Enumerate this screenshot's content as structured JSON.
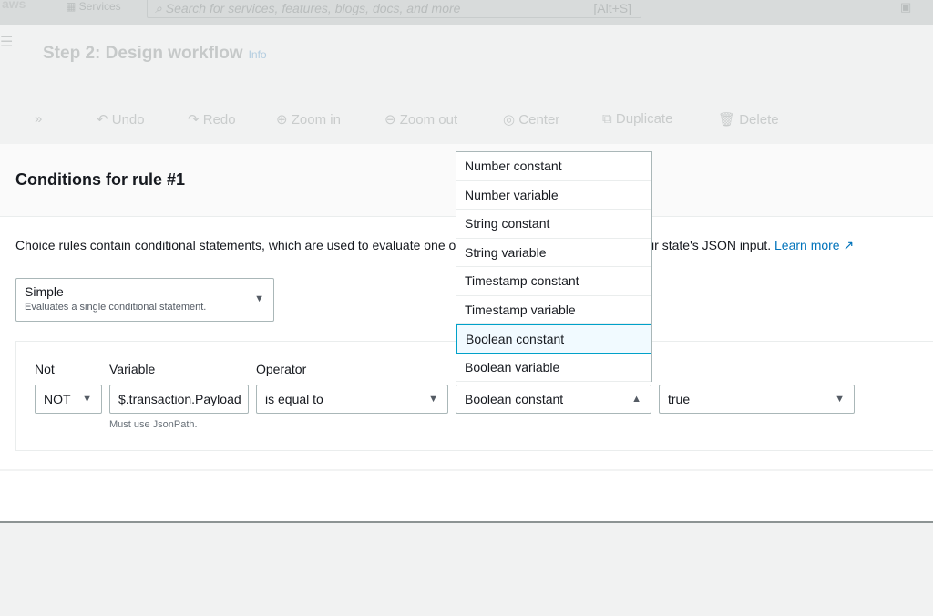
{
  "topnav": {
    "logo": "aws",
    "services": "Services",
    "search_placeholder": "Search for services, features, blogs, docs, and more",
    "search_shortcut": "[Alt+S]"
  },
  "header": {
    "title": "Step 2: Design workflow",
    "info": "Info"
  },
  "toolbar": {
    "items": [
      "Undo",
      "Redo",
      "Zoom in",
      "Zoom out",
      "Center",
      "Duplicate",
      "Delete"
    ]
  },
  "modal": {
    "title": "Conditions for rule #1",
    "description": "Choice rules contain conditional statements, which are used to evaluate one or more conditions (variables) in your state's JSON input.",
    "learn_more": "Learn more",
    "rule_type": {
      "value": "Simple",
      "sub": "Evaluates a single conditional statement."
    },
    "condition": {
      "not_label": "Not",
      "not_value": "NOT",
      "variable_label": "Variable",
      "variable_value": "$.transaction.Payload",
      "variable_hint": "Must use JsonPath.",
      "operator_label": "Operator",
      "operator_value": "is equal to",
      "type_value": "Boolean constant",
      "value": "true"
    },
    "type_options": [
      "Number constant",
      "Number variable",
      "String constant",
      "String variable",
      "Timestamp constant",
      "Timestamp variable",
      "Boolean constant",
      "Boolean variable"
    ],
    "highlighted_option": "Boolean constant"
  },
  "colors": {
    "link": "#0073bb",
    "highlight_border": "#00a1c9",
    "highlight_bg": "#f1faff"
  }
}
